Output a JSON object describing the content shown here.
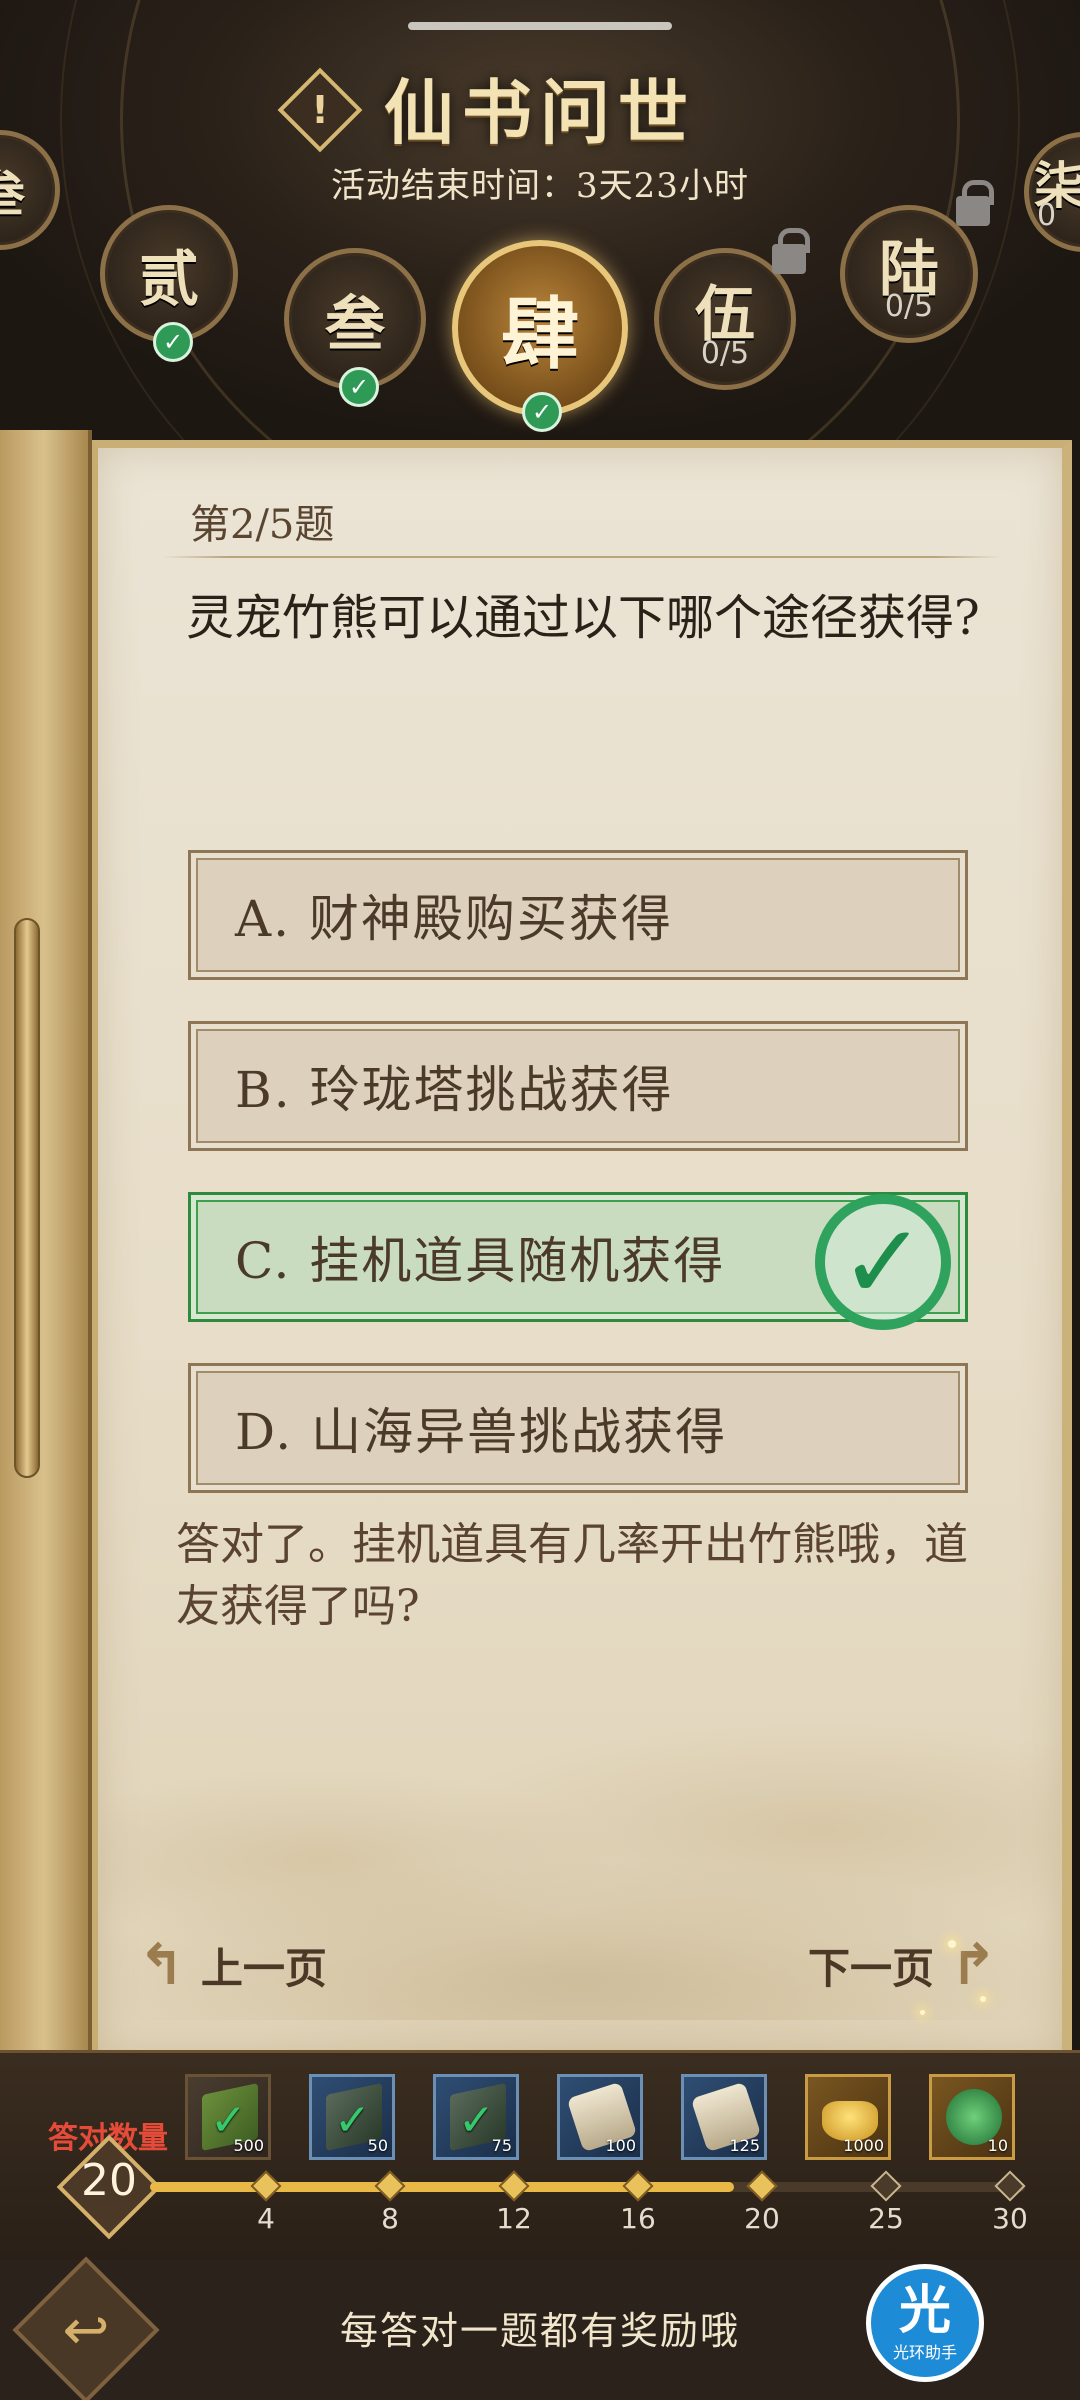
{
  "header": {
    "title": "仙书问世",
    "timer": "活动结束时间：3天23小时",
    "chapters": [
      {
        "glyph": "叁",
        "state": "done"
      },
      {
        "glyph": "贰",
        "state": "done"
      },
      {
        "glyph": "叁",
        "state": "done"
      },
      {
        "glyph": "肆",
        "state": "active"
      },
      {
        "glyph": "伍",
        "state": "locked",
        "progress": "0/5"
      },
      {
        "glyph": "陆",
        "state": "locked",
        "progress": "0/5"
      },
      {
        "glyph": "柒",
        "state": "locked",
        "progress": "0"
      }
    ],
    "check_glyph": "✓"
  },
  "question": {
    "number": "第2/5题",
    "text": "灵宠竹熊可以通过以下哪个途径获得?",
    "options": [
      {
        "label": "A. 财神殿购买获得",
        "correct": false
      },
      {
        "label": "B. 玲珑塔挑战获得",
        "correct": false
      },
      {
        "label": "C. 挂机道具随机获得",
        "correct": true
      },
      {
        "label": "D. 山海异兽挑战获得",
        "correct": false
      }
    ],
    "correct_mark": "✓",
    "feedback": "答对了。挂机道具有几率开出竹熊哦，道友获得了吗?"
  },
  "navigation": {
    "prev_label": "上一页",
    "next_label": "下一页",
    "prev_arrow": "↰",
    "next_arrow": "↱"
  },
  "rewards": {
    "answered_label": "答对数量",
    "answered_count": "20",
    "progress_fraction": 0.667,
    "milestones": [
      "4",
      "8",
      "12",
      "16",
      "20",
      "25",
      "30"
    ],
    "items": [
      {
        "icon": "green-book-icon",
        "qty": "500",
        "claimed": true,
        "frame": "dark"
      },
      {
        "icon": "slate-book-icon",
        "qty": "50",
        "claimed": true,
        "frame": "blue"
      },
      {
        "icon": "slate-book-icon",
        "qty": "75",
        "claimed": true,
        "frame": "blue"
      },
      {
        "icon": "scroll-icon",
        "qty": "100",
        "claimed": false,
        "frame": "blue"
      },
      {
        "icon": "scroll-icon",
        "qty": "125",
        "claimed": false,
        "frame": "blue"
      },
      {
        "icon": "gold-ingot-icon",
        "qty": "1000",
        "claimed": false,
        "frame": "gold"
      },
      {
        "icon": "jade-dragon-icon",
        "qty": "10",
        "claimed": false,
        "frame": "gold"
      }
    ]
  },
  "footer": {
    "hint": "每答对一题都有奖励哦",
    "back_arrow": "↩",
    "helper_big": "光",
    "helper_small": "光环助手"
  }
}
